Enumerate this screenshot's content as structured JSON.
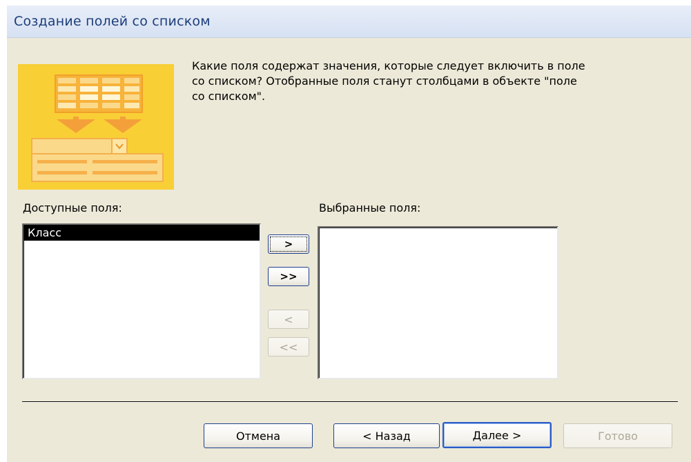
{
  "window": {
    "title": "Создание полей со списком"
  },
  "instruction": "Какие поля содержат значения, которые следует включить в поле\n со списком? Отобранные поля станут столбцами в объекте \"поле\nсо списком\".",
  "available": {
    "label": "Доступные поля:",
    "items": [
      {
        "label": "Класс",
        "selected": true
      }
    ]
  },
  "selected": {
    "label": "Выбранные поля:",
    "items": []
  },
  "move": {
    "add_one": ">",
    "add_all": ">>",
    "remove_one": "<",
    "remove_all": "<<"
  },
  "footer": {
    "cancel": "Отмена",
    "back": "< Назад",
    "next": "Далее >",
    "finish": "Готово"
  },
  "colors": {
    "title_text": "#1c3d7a",
    "dialog_bg": "#ece9d8",
    "wizard_art_bg": "#f9cf36",
    "button_border": "#1f3f8f"
  }
}
